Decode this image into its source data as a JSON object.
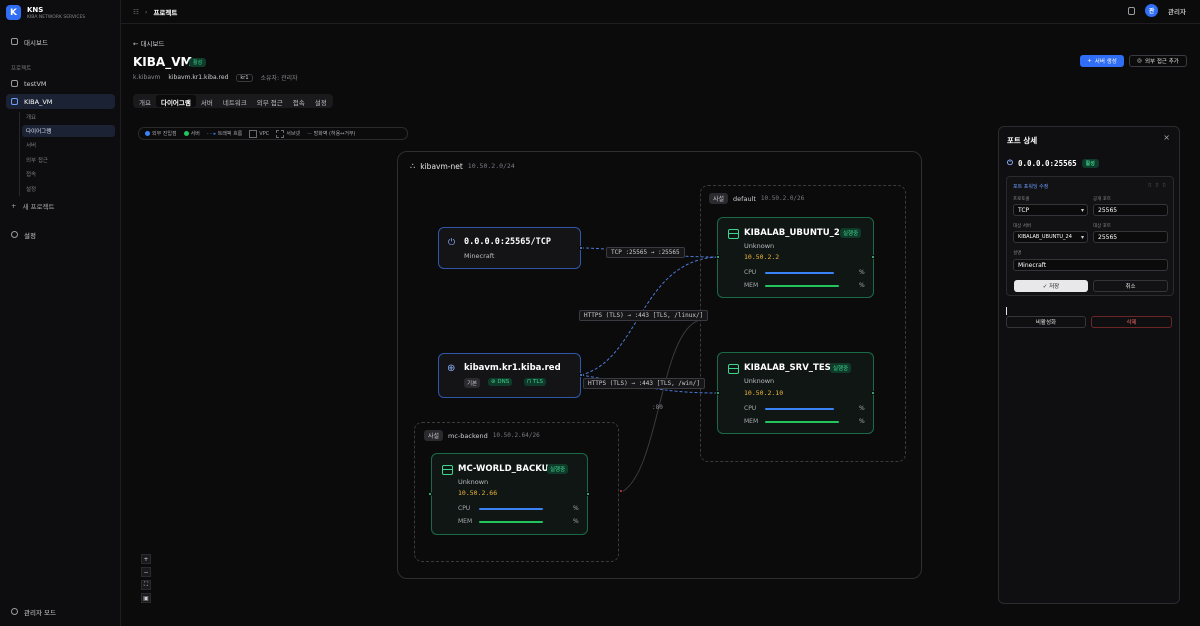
{
  "brand": {
    "logo": "K",
    "name": "KNS",
    "tagline": "KIBA NETWORK SERVICES"
  },
  "sidebar": {
    "dashboard": "대시보드",
    "projects_section": "프로젝트",
    "projects": [
      {
        "label": "testVM"
      },
      {
        "label": "KIBA_VM"
      }
    ],
    "subitems": [
      "개요",
      "다이어그램",
      "서버",
      "외부 접근",
      "접속",
      "설정"
    ],
    "new_project": "새 프로젝트",
    "settings": "설정",
    "admin_mode": "관리자 모드"
  },
  "topbar": {
    "crumb_icon": "☷",
    "crumb": "프로젝트",
    "user_initial": "관",
    "user": "관리자"
  },
  "page": {
    "back": "대시보드",
    "title": "KIBA_VM",
    "status": "활성",
    "id": "k.kibavm",
    "host": "kibavm.kr1.kiba.red",
    "region": "kr1",
    "owner": "소유자: 관리자",
    "create_server": "서버 생성",
    "add_external": "외부 접근 추가"
  },
  "tabs": [
    "개요",
    "다이어그램",
    "서버",
    "네트워크",
    "외부 접근",
    "접속",
    "설정"
  ],
  "legend": [
    "외부 진입점",
    "서버",
    "트래픽 흐름",
    "VPC",
    "서브넷",
    "방화벽 (허용↔거부)"
  ],
  "network": {
    "name": "kibavm-net",
    "cidr": "10.50.2.0/24"
  },
  "subnets": {
    "default": {
      "tag": "사설",
      "name": "default",
      "cidr": "10.50.2.0/26"
    },
    "backend": {
      "tag": "사설",
      "name": "mc-backend",
      "cidr": "10.50.2.64/26"
    }
  },
  "entries": {
    "tcp": {
      "title": "0.0.0.0:25565/TCP",
      "sub": "Minecraft"
    },
    "dns": {
      "title": "kibavm.kr1.kiba.red",
      "chip1": "기본",
      "chip2": "DNS",
      "chip3": "TLS"
    }
  },
  "servers": [
    {
      "name": "KIBALAB_UBUNTU_24",
      "status": "실행중",
      "os": "Unknown",
      "ip": "10.50.2.2",
      "cpu_label": "CPU",
      "mem_label": "MEM",
      "pct": "%",
      "cpu": 0.75,
      "mem": 0.8
    },
    {
      "name": "KIBALAB_SRV_TEST",
      "status": "실행중",
      "os": "Unknown",
      "ip": "10.50.2.10",
      "cpu_label": "CPU",
      "mem_label": "MEM",
      "pct": "%",
      "cpu": 0.75,
      "mem": 0.8
    },
    {
      "name": "MC-WORLD_BACKUP",
      "status": "실행중",
      "os": "Unknown",
      "ip": "10.50.2.66",
      "cpu_label": "CPU",
      "mem_label": "MEM",
      "pct": "%",
      "cpu": 0.7,
      "mem": 0.7
    }
  ],
  "edges": {
    "tcp": "TCP :25565 → :25565",
    "https1": "HTTPS (TLS) → :443 [TLS, /linux/]",
    "https2": "HTTPS (TLS) → :443 [TLS, /win/]",
    "port80": ":80"
  },
  "zoom": [
    "+",
    "−",
    "⛶",
    "▣"
  ],
  "panel": {
    "title": "포트 상세",
    "close": "×",
    "address": "0.0.0.0:25565",
    "status": "활성",
    "edit_title": "포트 포워딩 수정",
    "edit_dots": "⠿ ⠿ ⠿",
    "protocol_label": "프로토콜",
    "protocol": "TCP",
    "public_port_label": "공개 포트",
    "public_port": "25565",
    "target_server_label": "대상 서버",
    "target_server": "KIBALAB_UBUNTU_24",
    "target_port_label": "대상 포트",
    "target_port": "25565",
    "desc_label": "설명",
    "desc": "Minecraft",
    "save": "✓ 저장",
    "cancel": "취소",
    "disable": "비활성화",
    "delete": "삭제"
  }
}
